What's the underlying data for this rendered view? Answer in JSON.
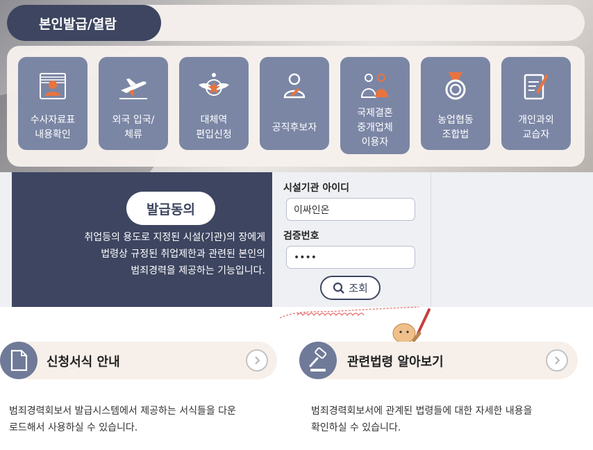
{
  "header": {
    "title": "본인발급/열람"
  },
  "tiles": [
    {
      "label": "수사자료표\n내용확인",
      "icon": "id-card-icon"
    },
    {
      "label": "외국 입국/\n체류",
      "icon": "airplane-icon"
    },
    {
      "label": "대체역\n편입신청",
      "icon": "military-emblem-icon"
    },
    {
      "label": "공직후보자",
      "icon": "person-icon"
    },
    {
      "label": "국제결혼\n중개업체\n이용자",
      "icon": "couple-icon"
    },
    {
      "label": "농업협동\n조합법",
      "icon": "medal-icon"
    },
    {
      "label": "개인과외\n교습자",
      "icon": "document-pen-icon"
    }
  ],
  "agree": {
    "title": "발급동의",
    "description": "취업등의 용도로 지정된 시설(기관)의 장에게\n법령상 규정된 취업제한과 관련된 본인의\n범죄경력을 제공하는 기능입니다."
  },
  "form": {
    "facility_id_label": "시설기관 아이디",
    "facility_id_value": "이싸인온",
    "verify_label": "검증번호",
    "verify_value": "••••",
    "search_label": "조회"
  },
  "links": [
    {
      "title": "신청서식 안내",
      "icon": "document-icon",
      "description": "범죄경력회보서 발급시스템에서 제공하는 서식들을 다운\n로드해서 사용하실 수 있습니다."
    },
    {
      "title": "관련법령 알아보기",
      "icon": "gavel-icon",
      "description": "범죄경력회보서에 관계된 법령들에 대한 자세한 내용을\n확인하실 수 있습니다."
    }
  ],
  "colors": {
    "navy": "#3d4560",
    "tile": "#7b86a5",
    "accent": "#e9743e",
    "pill": "#f7efe9"
  }
}
